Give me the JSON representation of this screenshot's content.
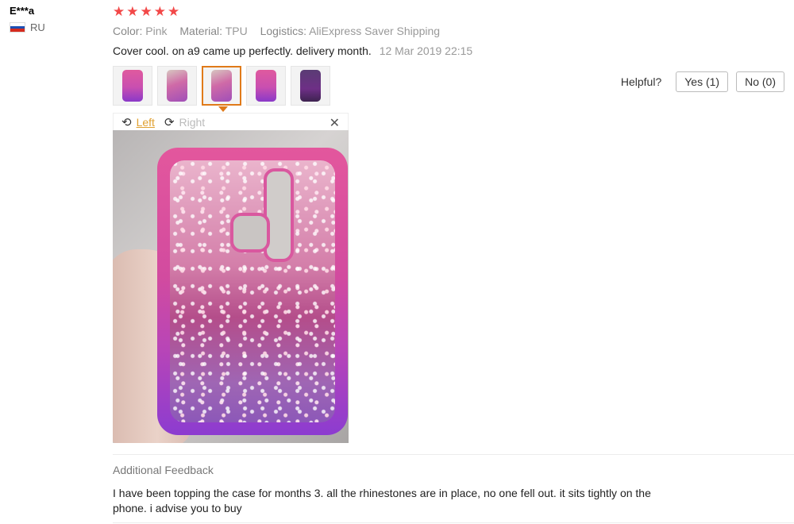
{
  "user": {
    "name": "E***a",
    "country": "RU"
  },
  "rating": {
    "stars": 5
  },
  "attributes": [
    {
      "label": "Color:",
      "value": "Pink"
    },
    {
      "label": "Material:",
      "value": "TPU"
    },
    {
      "label": "Logistics:",
      "value": "AliExpress Saver Shipping"
    }
  ],
  "review": {
    "text": "Cover cool. on a9 came up perfectly. delivery month.",
    "date": "12 Mar 2019 22:15"
  },
  "thumbnails": {
    "count": 5,
    "selected_index": 2
  },
  "viewer": {
    "rotate_left": "Left",
    "rotate_right": "Right"
  },
  "helpful": {
    "label": "Helpful?",
    "yes": "Yes (1)",
    "no": "No (0)"
  },
  "additional": {
    "title": "Additional Feedback",
    "text": "I have been topping the case for months 3. all the rhinestones are in place, no one fell out. it sits tightly on the phone. i advise you to buy"
  },
  "colors": {
    "star": "#f24848",
    "selected_thumb": "#e07a19",
    "link": "#e0a030"
  }
}
